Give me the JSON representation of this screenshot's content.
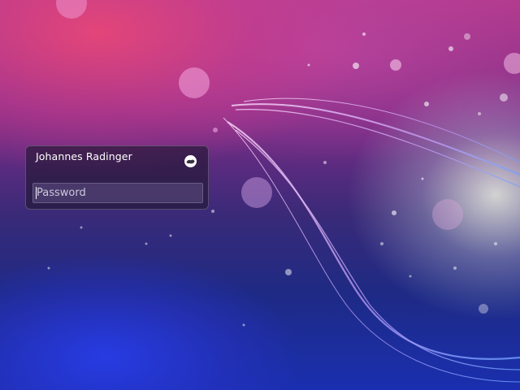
{
  "login": {
    "user_name": "Johannes Radinger",
    "password_placeholder": "Password"
  },
  "icons": {
    "session": "session-selector-icon"
  },
  "colors": {
    "card_background": "#1e1630",
    "text": "#ffffff"
  }
}
